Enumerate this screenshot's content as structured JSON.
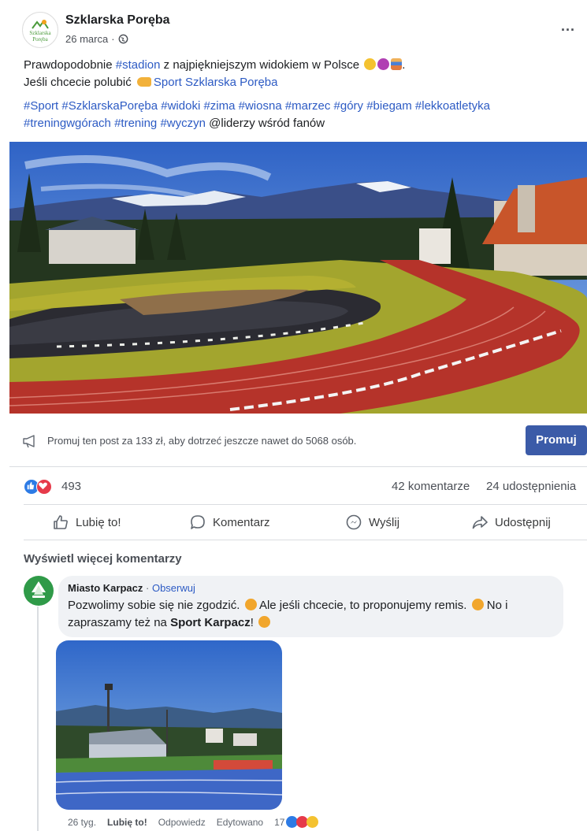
{
  "post": {
    "page_name": "Szklarska Poręba",
    "page_avatar_text": "Szklarska Poręba",
    "date": "26 marca",
    "more_label": "...",
    "line1_pre": "Prawdopodobnie ",
    "line1_link": "#stadion",
    "line1_post": " z najpiękniejszym widokiem w Polsce",
    "line2_pre": "Jeśli chcecie polubić",
    "line2_link": "Sport Szklarska Poręba",
    "hashtags_line1": "#Sport #SzklarskaPoręba #widoki #zima #wiosna #marzec #góry #biegam #lekkoatletyka",
    "hashtags_line2": "#treningwgórach #trening #wyczyn",
    "mention": "@liderzy wśród fanów"
  },
  "promo": {
    "text": "Promuj ten post za 133 zł, aby dotrzeć jeszcze nawet do 5068 osób.",
    "button": "Promuj"
  },
  "stats": {
    "reactions": "493",
    "comments": "42 komentarze",
    "shares": "24 udostępnienia"
  },
  "actions": {
    "like": "Lubię to!",
    "comment": "Komentarz",
    "send": "Wyślij",
    "share": "Udostępnij"
  },
  "comments_section": {
    "more": "Wyświetl więcej komentarzy",
    "author": "Miasto Karpacz",
    "follow": "Obserwuj",
    "line1_a": "Pozwolimy sobie się nie zgodzić.",
    "line1_b": " Ale jeśli chcecie, to proponujemy remis.",
    "line1_c": " No i",
    "line2_a": "zapraszamy też na ",
    "line2_bold": "Sport Karpacz",
    "line2_c": "!",
    "time": "26 tyg.",
    "like": "Lubię to!",
    "reply": "Odpowiedz",
    "edited": "Edytowano",
    "reaction_count": "17"
  },
  "colors": {
    "link": "#2d5bc4",
    "promote_button": "#3b5ba8",
    "track": "#b5332a",
    "grass": "#a3a52e"
  }
}
